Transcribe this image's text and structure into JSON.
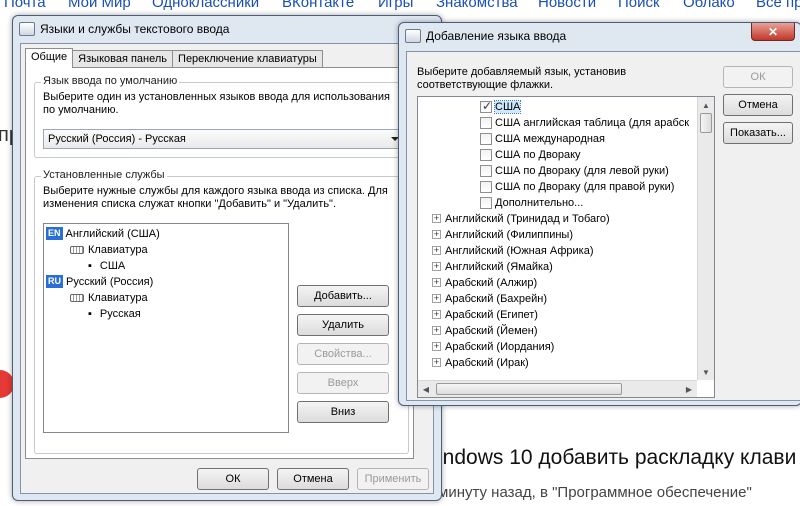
{
  "background": {
    "nav": [
      "Почта",
      "Мой Мир",
      "Одноклассники",
      "ВКонтакте",
      "Игры",
      "Знакомства",
      "Новости",
      "Поиск",
      "Облако",
      "Все пр"
    ],
    "side_text": "пр",
    "article_title": "indows 10 добавить раскладку клави",
    "article_meta": "минуту назад, в \"Программное обеспечение\""
  },
  "main_dialog": {
    "title": "Языки и службы текстового ввода",
    "tabs": [
      "Общие",
      "Языковая панель",
      "Переключение клавиатуры"
    ],
    "default_group": {
      "title": "Язык ввода по умолчанию",
      "description": "Выберите один из установленных языков ввода для использования по умолчанию.",
      "selected": "Русский (Россия) - Русская"
    },
    "services_group": {
      "title": "Установленные службы",
      "description": "Выберите нужные службы для каждого языка ввода из списка. Для изменения списка служат кнопки \"Добавить\" и \"Удалить\".",
      "tree": {
        "lang1_code": "EN",
        "lang1": "Английский (США)",
        "lang1_kbd": "Клавиатура",
        "lang1_layout": "США",
        "lang2_code": "RU",
        "lang2": "Русский (Россия)",
        "lang2_kbd": "Клавиатура",
        "lang2_layout": "Русская"
      },
      "buttons": {
        "add": "Добавить...",
        "remove": "Удалить",
        "properties": "Свойства...",
        "up": "Вверх",
        "down": "Вниз"
      }
    },
    "footer": {
      "ok": "ОК",
      "cancel": "Отмена",
      "apply": "Применить"
    }
  },
  "add_dialog": {
    "title": "Добавление языка ввода",
    "instruction": "Выберите добавляемый язык, установив соответствующие флажки.",
    "buttons": {
      "ok": "ОК",
      "cancel": "Отмена",
      "preview": "Показать..."
    },
    "layouts": [
      {
        "label": "США",
        "checked": true
      },
      {
        "label": "США английская таблица (для арабск",
        "checked": false
      },
      {
        "label": "США международная",
        "checked": false
      },
      {
        "label": "США по Двораку",
        "checked": false
      },
      {
        "label": "США по Двораку (для левой руки)",
        "checked": false
      },
      {
        "label": "США по Двораку (для правой руки)",
        "checked": false
      },
      {
        "label": "Дополнительно...",
        "checked": false
      }
    ],
    "languages": [
      "Английский (Тринидад и Тобаго)",
      "Английский (Филиппины)",
      "Английский (Южная Африка)",
      "Английский (Ямайка)",
      "Арабский (Алжир)",
      "Арабский (Бахрейн)",
      "Арабский (Египет)",
      "Арабский (Йемен)",
      "Арабский (Иордания)",
      "Арабский (Ирак)"
    ]
  }
}
